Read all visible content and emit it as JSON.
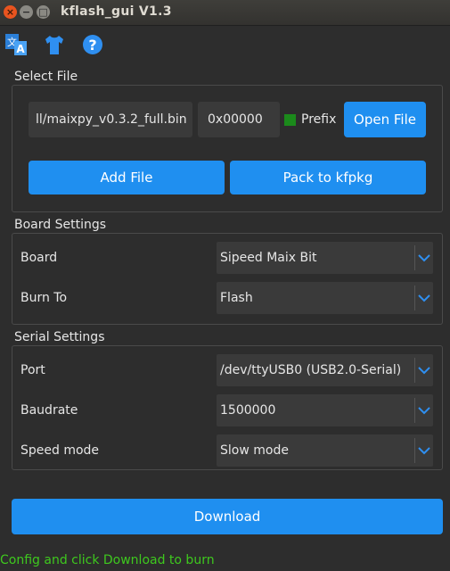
{
  "window": {
    "title": "kflash_gui V1.3",
    "close_glyph": "×",
    "min_glyph": "−",
    "max_glyph": "□"
  },
  "toolbar": {
    "icons": [
      "translate-icon",
      "tshirt-icon",
      "help-icon"
    ],
    "accent": "#1f8ff0"
  },
  "select_file": {
    "title": "Select File",
    "path_value": "ll/maixpy_v0.3.2_full.bin",
    "address_value": "0x00000",
    "prefix_label": "Prefix",
    "prefix_checked": true,
    "open_file_label": "Open File",
    "add_file_label": "Add File",
    "pack_label": "Pack to kfpkg"
  },
  "board_settings": {
    "title": "Board Settings",
    "board_label": "Board",
    "board_value": "Sipeed Maix Bit",
    "burn_to_label": "Burn To",
    "burn_to_value": "Flash"
  },
  "serial_settings": {
    "title": "Serial Settings",
    "port_label": "Port",
    "port_value": "/dev/ttyUSB0 (USB2.0-Serial)",
    "baudrate_label": "Baudrate",
    "baudrate_value": "1500000",
    "speed_label": "Speed mode",
    "speed_value": "Slow mode"
  },
  "download_label": "Download",
  "status_text": "Config and click Download to burn",
  "colors": {
    "background": "#2d2d2d",
    "button": "#1f8ff0",
    "checkbox": "#1b8a1b",
    "status": "#3ec81e"
  }
}
